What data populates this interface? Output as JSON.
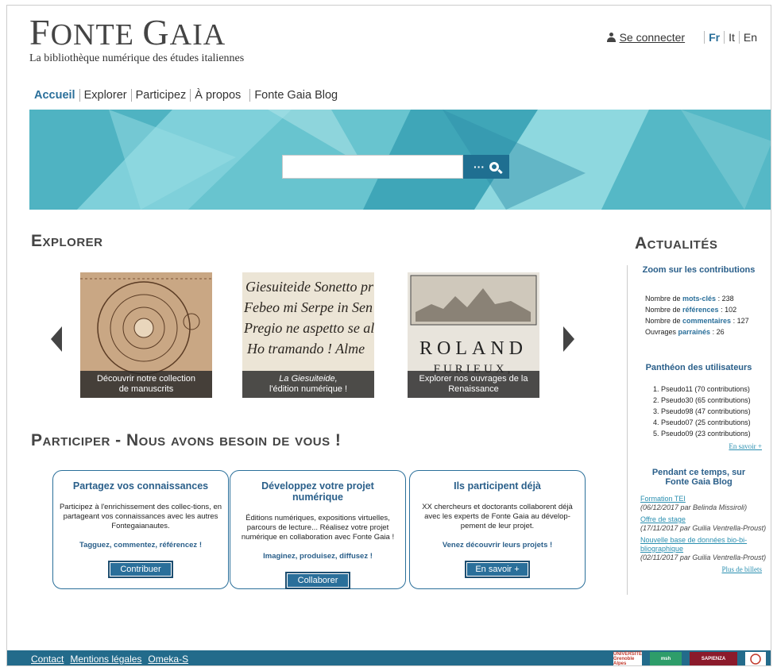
{
  "logo": {
    "title_first": "F",
    "title_rest": "ONTE ",
    "title_second": "G",
    "title_rest2": "AIA",
    "subtitle": "La bibliothèque numérique des études italiennes"
  },
  "top_bar": {
    "login_label": "Se connecter",
    "languages": [
      "Fr",
      "It",
      "En"
    ],
    "active_language": "Fr"
  },
  "nav": [
    "Accueil",
    "Explorer",
    "Participez",
    "À propos",
    "Fonte Gaia Blog"
  ],
  "search": {
    "placeholder": "",
    "dots": "···"
  },
  "explorer": {
    "title": "Explorer",
    "cards": [
      {
        "caption_line1": "Découvrir notre collection",
        "caption_line2": "de manuscrits"
      },
      {
        "caption_line1": "La Giesuiteide,",
        "caption_line2": "l'édition numérique !"
      },
      {
        "caption_line1": "Explorer nos ouvrages de la",
        "caption_line2": "Renaissance"
      }
    ]
  },
  "participer": {
    "title": "Participer - Nous avons besoin de vous !",
    "boxes": [
      {
        "title": "Partagez vos connaissances",
        "text": "Participez à l'enrichissement des collec-tions, en partageant vos connaissances avec les autres Fontegaianautes.",
        "cta": "Tagguez, commentez, référencez !",
        "button": "Contribuer"
      },
      {
        "title": "Développez votre projet numérique",
        "text": "Éditions numériques, expositions virtuelles, parcours de lecture... Réalisez votre projet numérique en collaboration avec Fonte Gaia !",
        "cta": "Imaginez, produisez, diffusez !",
        "button": "Collaborer"
      },
      {
        "title": "Ils participent déjà",
        "text": "XX chercheurs et doctorants collaborent déjà avec les experts de Fonte Gaia au dévelop-pement de leur projet.",
        "cta": "Venez découvrir leurs projets !",
        "button": "En savoir +"
      }
    ]
  },
  "actualites": {
    "title": "Actualités",
    "zoom_title": "Zoom sur les contributions",
    "stats": [
      {
        "prefix": "Nombre de ",
        "hl": "mots-clés",
        "value": " : 238"
      },
      {
        "prefix": "Nombre de ",
        "hl": "références",
        "value": " : 102"
      },
      {
        "prefix": "Nombre de ",
        "hl": "commentaires",
        "value": " : 127"
      },
      {
        "prefix": "Ouvrages ",
        "hl": "parrainés",
        "value": " : 26"
      }
    ],
    "pantheon_title": "Panthéon des utilisateurs",
    "pantheon": [
      "1. Pseudo11 (70 contributions)",
      "2. Pseudo30 (65 contributions)",
      "3. Pseudo98 (47 contributions)",
      "4. Pseudo07 (25 contributions)",
      "5. Pseudo09 (23 contributions)"
    ],
    "more_label": "En savoir +",
    "blog_title_line1": "Pendant ce temps, sur",
    "blog_title_line2": "Fonte Gaia Blog",
    "blog": [
      {
        "link": "Formation TEI",
        "meta": "(06/12/2017 par Belinda Missiroli)"
      },
      {
        "link": "Offre de stage",
        "meta": "(17/11/2017 par Guilia Ventrella-Proust)"
      },
      {
        "link": "Nouvelle base de données bio-bi-bliographique",
        "meta": "(02/11/2017 par Guilia Ventrella-Proust)"
      }
    ],
    "more_posts_label": "Plus de billets"
  },
  "footer": {
    "links": [
      "Contact",
      "Mentions légales",
      "Omeka-S"
    ],
    "partners": [
      "UNIVERSITÉ Grenoble Alpes",
      "msh",
      "SAPIENZA",
      ""
    ]
  },
  "colors": {
    "accent": "#2a6f9a",
    "footer": "#236b8b",
    "banner": "#5fbfcc"
  }
}
